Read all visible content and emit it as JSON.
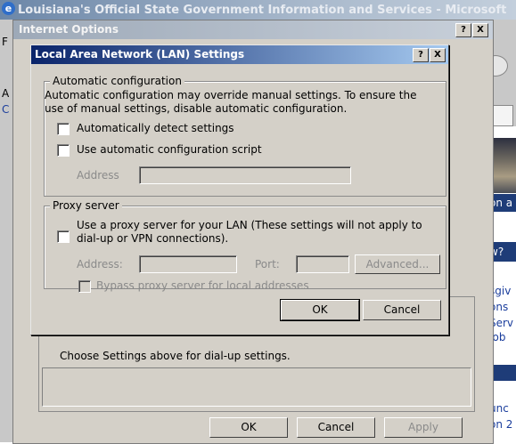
{
  "browser": {
    "window_title": "Louisiana's Official State Government Information and Services - Microsoft",
    "left_letters": [
      "F",
      "A",
      "C"
    ],
    "site_texts": [
      "on a",
      "w?"
    ],
    "site_links": [
      "sgiv",
      "ons",
      "Serv",
      "Job",
      "unc",
      "on 2"
    ]
  },
  "internet_options": {
    "title": "Internet Options",
    "help_btn": "?",
    "close_btn": "X",
    "dialup_text": "Choose Settings above for dial-up settings.",
    "ok_label": "OK",
    "cancel_label": "Cancel",
    "apply_label": "Apply"
  },
  "lan": {
    "title": "Local Area Network (LAN) Settings",
    "help_btn": "?",
    "close_btn": "X",
    "auto": {
      "group_label": "Automatic configuration",
      "description": "Automatic configuration may override manual settings.  To ensure the use of manual settings, disable automatic configuration.",
      "auto_detect_label": "Automatically detect settings",
      "auto_detect_checked": false,
      "script_label": "Use automatic configuration script",
      "script_checked": false,
      "address_label": "Address",
      "address_value": ""
    },
    "proxy": {
      "group_label": "Proxy server",
      "use_proxy_label": "Use a proxy server for your LAN (These settings will not apply to dial-up or VPN connections).",
      "use_proxy_checked": false,
      "address_label": "Address:",
      "address_value": "",
      "port_label": "Port:",
      "port_value": "",
      "advanced_label": "Advanced...",
      "bypass_label": "Bypass proxy server for local addresses",
      "bypass_checked": false
    },
    "ok_label": "OK",
    "cancel_label": "Cancel"
  }
}
